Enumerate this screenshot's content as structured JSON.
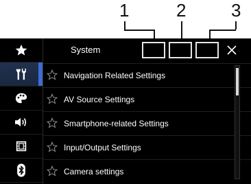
{
  "callouts": [
    "1",
    "2",
    "3"
  ],
  "header": {
    "title": "System"
  },
  "sidebar": {
    "items": [
      {
        "icon": "star-icon"
      },
      {
        "icon": "tools-icon"
      },
      {
        "icon": "palette-icon"
      },
      {
        "icon": "speaker-icon"
      },
      {
        "icon": "film-icon"
      },
      {
        "icon": "bluetooth-icon"
      }
    ],
    "active_index": 1
  },
  "menu": {
    "items": [
      {
        "label": "Navigation Related Settings"
      },
      {
        "label": "AV Source Settings"
      },
      {
        "label": "Smartphone-related Settings"
      },
      {
        "label": "Input/Output Settings"
      },
      {
        "label": "Camera settings"
      }
    ]
  },
  "colors": {
    "accent": "#3f6cd1",
    "background": "#000000",
    "text": "#ffffff"
  }
}
